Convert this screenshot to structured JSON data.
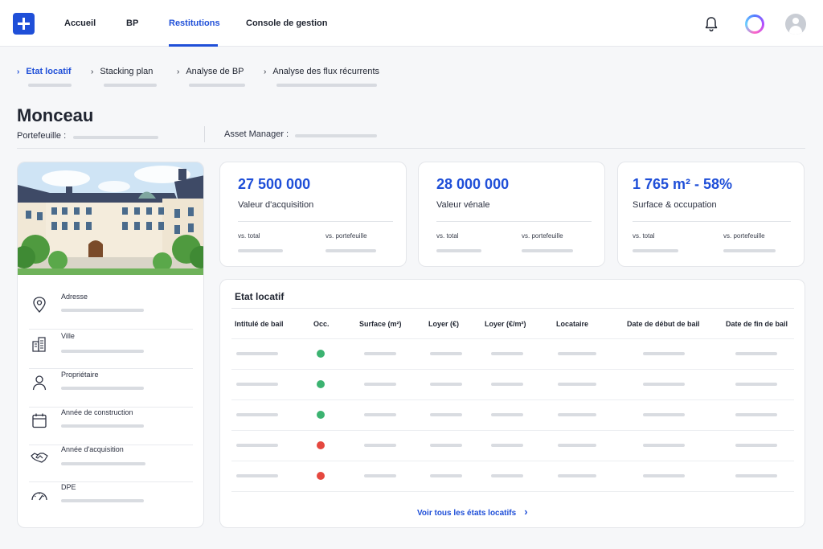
{
  "nav": {
    "items": [
      {
        "label": "Accueil",
        "active": false
      },
      {
        "label": "BP",
        "active": false
      },
      {
        "label": "Restitutions",
        "active": true
      },
      {
        "label": "Console de gestion",
        "active": false
      }
    ],
    "accent_color": "#1f4fd8"
  },
  "subnav": {
    "items": [
      {
        "label": "Etat locatif",
        "active": true
      },
      {
        "label": "Stacking plan",
        "active": false
      },
      {
        "label": "Analyse de BP",
        "active": false
      },
      {
        "label": "Analyse des flux récurrents",
        "active": false
      }
    ]
  },
  "page": {
    "title": "Monceau",
    "portfolio_label": "Portefeuille :",
    "asset_manager_label": "Asset Manager :"
  },
  "property": {
    "fields": [
      {
        "label": "Adresse",
        "icon": "map-pin-icon"
      },
      {
        "label": "Ville",
        "icon": "city-icon"
      },
      {
        "label": "Propriétaire",
        "icon": "user-icon"
      },
      {
        "label": "Année de construction",
        "icon": "calendar-icon"
      },
      {
        "label": "Année d'acquisition",
        "icon": "handshake-icon"
      },
      {
        "label": "DPE",
        "icon": "gauge-icon"
      }
    ]
  },
  "kpis": [
    {
      "value": "27 500 000",
      "caption": "Valeur d'acquisition",
      "left_label": "vs. total",
      "right_label": "vs. portefeuille"
    },
    {
      "value": "28 000 000",
      "caption": "Valeur vénale",
      "left_label": "vs. total",
      "right_label": "vs. portefeuille"
    },
    {
      "value": "1 765 m² - 58%",
      "caption": "Surface & occupation",
      "left_label": "vs. total",
      "right_label": "vs. portefeuille"
    }
  ],
  "table": {
    "title": "Etat locatif",
    "columns": [
      "Intitulé de bail",
      "Occ.",
      "Surface (m²)",
      "Loyer (€)",
      "Loyer (€/m²)",
      "Locataire",
      "Date de début de bail",
      "Date de fin de bail"
    ],
    "rows_status": [
      "occupied",
      "occupied",
      "occupied",
      "vacant",
      "vacant"
    ],
    "status_colors": {
      "occupied": "#3cb371",
      "vacant": "#e5483f"
    },
    "see_all_label": "Voir tous les états locatifs"
  }
}
